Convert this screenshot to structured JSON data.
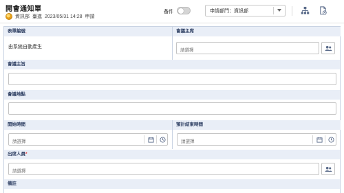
{
  "header": {
    "title": "開會通知單",
    "department": "資訊部",
    "user": "臺進",
    "datetime": "2023/05/31 14:28",
    "action": "申請"
  },
  "draft": {
    "label": "备件",
    "on": false
  },
  "dept_select": {
    "value": "申請部門：資訊部"
  },
  "icons": {
    "org": "org-chart-icon",
    "doc": "document-settings-icon",
    "people": "people-icon",
    "calendar": "calendar-icon",
    "clock": "clock-icon"
  },
  "form": {
    "form_type": {
      "label": "表單編號",
      "value": "由系統自動產生"
    },
    "host": {
      "label": "會議主席",
      "placeholder": "請選擇"
    },
    "subject": {
      "label": "會議主旨",
      "value": ""
    },
    "location": {
      "label": "會議地點",
      "value": ""
    },
    "start": {
      "label": "開始時間",
      "placeholder": "請選擇"
    },
    "end": {
      "label": "預計結束時間",
      "placeholder": "請選擇"
    },
    "attendees": {
      "label": "出席人員",
      "required_mark": "*",
      "placeholder": "請選擇"
    },
    "remark": {
      "label": "備註"
    }
  },
  "colors": {
    "section_bg": "#e9eef7",
    "section_text": "#2d3e62",
    "border": "#c9d3e3"
  }
}
